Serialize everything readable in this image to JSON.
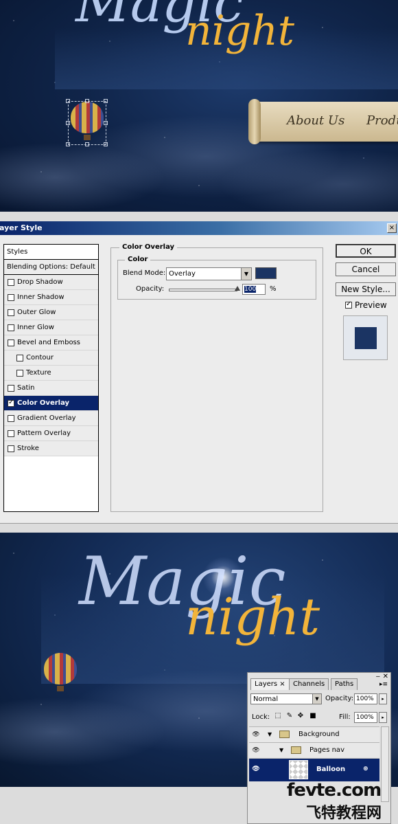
{
  "top_canvas": {
    "logo_magic": "Magic",
    "logo_night": "night",
    "nav": {
      "about": "About Us",
      "products": "Products"
    }
  },
  "dialog": {
    "title": "Layer Style",
    "close_glyph": "×",
    "styles_header": "Styles",
    "blending_options": "Blending Options: Default",
    "style_items": [
      {
        "label": "Drop Shadow",
        "checked": false,
        "sub": false,
        "selected": false
      },
      {
        "label": "Inner Shadow",
        "checked": false,
        "sub": false,
        "selected": false
      },
      {
        "label": "Outer Glow",
        "checked": false,
        "sub": false,
        "selected": false
      },
      {
        "label": "Inner Glow",
        "checked": false,
        "sub": false,
        "selected": false
      },
      {
        "label": "Bevel and Emboss",
        "checked": false,
        "sub": false,
        "selected": false
      },
      {
        "label": "Contour",
        "checked": false,
        "sub": true,
        "selected": false
      },
      {
        "label": "Texture",
        "checked": false,
        "sub": true,
        "selected": false
      },
      {
        "label": "Satin",
        "checked": false,
        "sub": false,
        "selected": false
      },
      {
        "label": "Color Overlay",
        "checked": true,
        "sub": false,
        "selected": true
      },
      {
        "label": "Gradient Overlay",
        "checked": false,
        "sub": false,
        "selected": false
      },
      {
        "label": "Pattern Overlay",
        "checked": false,
        "sub": false,
        "selected": false
      },
      {
        "label": "Stroke",
        "checked": false,
        "sub": false,
        "selected": false
      }
    ],
    "panel_title": "Color Overlay",
    "group_title": "Color",
    "blend_mode_label": "Blend Mode:",
    "blend_mode_value": "Overlay",
    "overlay_color": "#1b3463",
    "opacity_label": "Opacity:",
    "opacity_value": "100",
    "opacity_unit": "%",
    "buttons": {
      "ok": "OK",
      "cancel": "Cancel",
      "new_style": "New Style..."
    },
    "preview_label": "Preview",
    "preview_checked": true
  },
  "bottom_canvas": {
    "logo_magic": "Magic",
    "logo_night": "night"
  },
  "layers_panel": {
    "tabs": [
      "Layers",
      "Channels",
      "Paths"
    ],
    "active_tab": "Layers",
    "blend_mode": "Normal",
    "opacity_label": "Opacity:",
    "opacity_value": "100%",
    "lock_label": "Lock:",
    "fill_label": "Fill:",
    "fill_value": "100%",
    "layers": [
      {
        "name": "Background",
        "type": "group",
        "depth": 0,
        "selected": false
      },
      {
        "name": "Pages nav",
        "type": "group",
        "depth": 1,
        "selected": false
      },
      {
        "name": "Balloon",
        "type": "layer",
        "depth": 2,
        "selected": true
      }
    ]
  },
  "watermark": {
    "latin": "fevte.com",
    "chinese": "飞特教程网"
  }
}
